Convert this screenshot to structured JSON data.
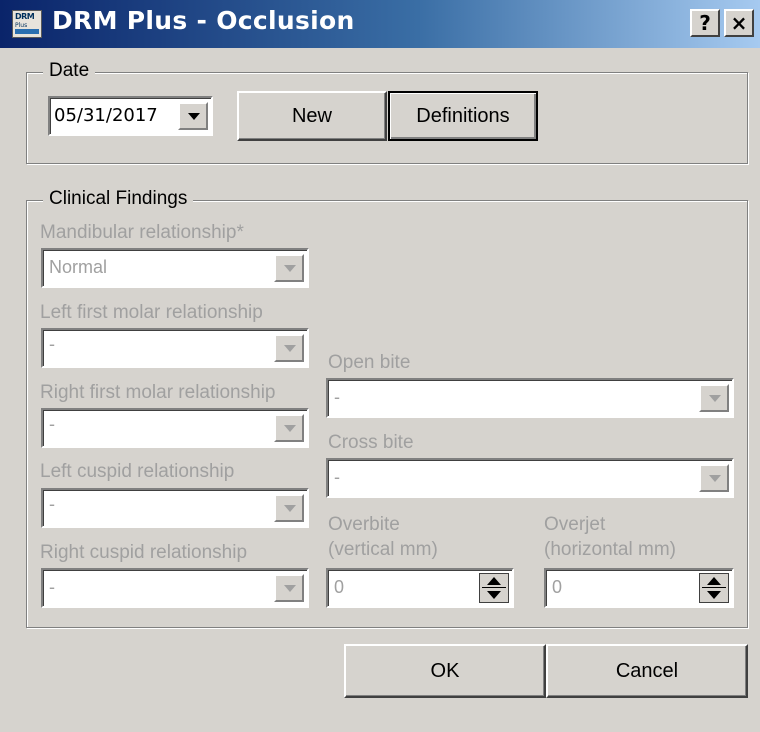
{
  "window": {
    "title": "DRM Plus - Occlusion",
    "icon_text_top": "DRM",
    "icon_text_bottom": "Plus",
    "help_label": "?",
    "close_label": "×"
  },
  "date_group": {
    "legend": "Date",
    "date_value": "05/31/2017",
    "new_label": "New",
    "definitions_label": "Definitions"
  },
  "clinical": {
    "legend": "Clinical Findings",
    "mandibular": {
      "label": "Mandibular relationship*",
      "value": "Normal"
    },
    "left_first_molar": {
      "label": "Left first molar relationship",
      "value": "-"
    },
    "right_first_molar": {
      "label": "Right first molar relationship",
      "value": "-"
    },
    "left_cuspid": {
      "label": "Left cuspid relationship",
      "value": "-"
    },
    "right_cuspid": {
      "label": "Right cuspid relationship",
      "value": "-"
    },
    "open_bite": {
      "label": "Open bite",
      "value": "-"
    },
    "cross_bite": {
      "label": "Cross bite",
      "value": "-"
    },
    "overbite": {
      "label_line1": "Overbite",
      "label_line2": "(vertical mm)",
      "value": "0"
    },
    "overjet": {
      "label_line1": "Overjet",
      "label_line2": "(horizontal mm)",
      "value": "0"
    }
  },
  "footer": {
    "ok_label": "OK",
    "cancel_label": "Cancel"
  },
  "colors": {
    "title_gradient_start": "#0a246a",
    "title_gradient_end": "#a6caf0",
    "dialog_bg": "#d6d3ce",
    "disabled_text": "#a0a0a0"
  }
}
